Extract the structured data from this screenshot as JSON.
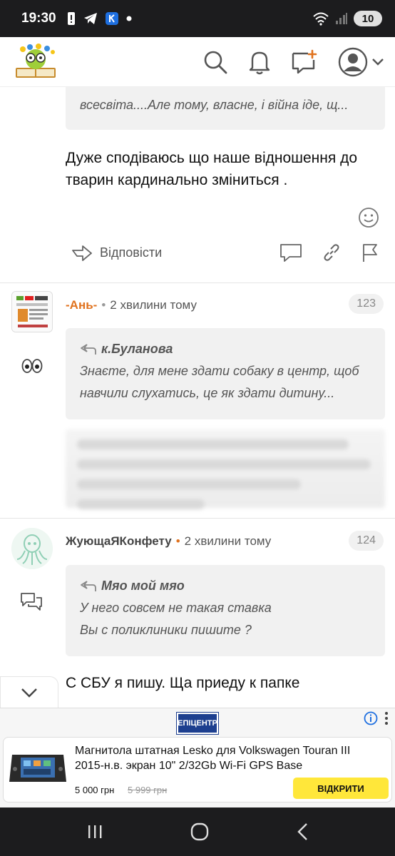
{
  "status_bar": {
    "time": "19:30",
    "battery": "10",
    "icons": [
      "alert-icon",
      "telegram-icon",
      "app-k-icon",
      "dot-icon",
      "wifi-icon",
      "signal-icon"
    ]
  },
  "header": {
    "icons": [
      "search-icon",
      "bell-icon",
      "new-post-icon",
      "avatar-icon",
      "chevron-down-icon"
    ]
  },
  "comment_1": {
    "quote_snippet": "всесвіта....Але тому, власне, і війна іде, щ...",
    "text": "Дуже сподіваюсь що наше відношення до тварин кардинально зміниться .",
    "reply_label": "Відповісти"
  },
  "comment_2": {
    "author": "-Ань-",
    "time": "2 хвилини тому",
    "number": "123",
    "quote_author": "к.Буланова",
    "quote_line_1": "Знаєте, для мене здати собаку в центр, щоб",
    "quote_line_2": "навчили слухатись, це як здати дитину...",
    "side_icon": "eyes-icon",
    "accent_color": "#e0721e"
  },
  "comment_3": {
    "author": "ЖующаЯКонфету",
    "time": "2 хвилини тому",
    "number": "124",
    "quote_author": "Мяо мой мяо",
    "quote_line_1": "У него совсем не такая ставка",
    "quote_line_2": "Вы с поликлиники пишите ?",
    "text": "С СБУ я пишу. Ща приеду к папке",
    "side_icon": "chat-icon"
  },
  "ad": {
    "brand": "ЕПІЦЕНТР",
    "title": "Магнитола штатная Lesko для Volkswagen Touran III 2015-н.в. экран 10\" 2/32Gb Wi-Fi GPS Base",
    "price": "5 000 грн",
    "old_price": "5 999 грн",
    "cta": "ВІДКРИТИ"
  },
  "colors": {
    "status_bar_bg": "#1c1c1e",
    "quote_bg": "#f1f1f1",
    "cta_bg": "#ffe73a",
    "accent": "#e0721e"
  }
}
